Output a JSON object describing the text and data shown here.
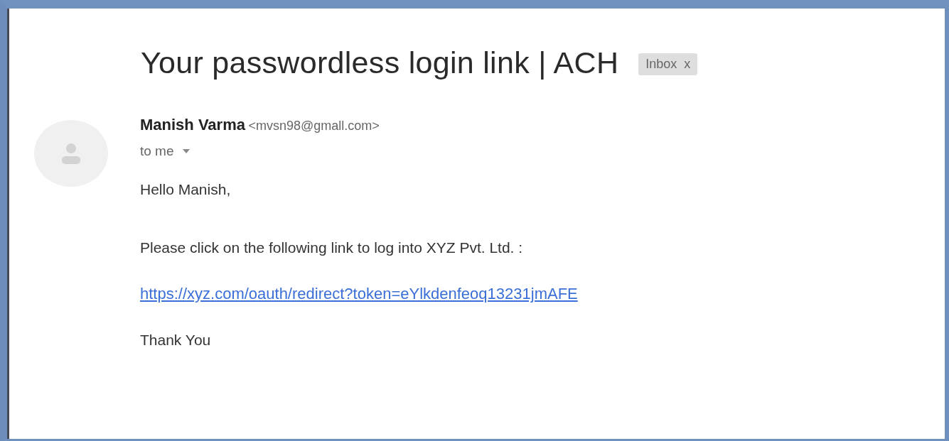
{
  "subject": "Your passwordless login link | ACH",
  "label": {
    "text": "Inbox",
    "close": "x"
  },
  "sender": {
    "name": "Manish Varma",
    "email": "<mvsn98@gmall.com>"
  },
  "recipient": "to me",
  "body": [
    {
      "kind": "text",
      "text": "Hello Manish,"
    },
    {
      "kind": "text",
      "text": "Please click on the following link to log into XYZ Pvt. Ltd. :"
    },
    {
      "kind": "link",
      "text": "https://xyz.com/oauth/redirect?token=eYlkdenfeoq13231jmAFE"
    },
    {
      "kind": "text",
      "text": "Thank You"
    }
  ]
}
